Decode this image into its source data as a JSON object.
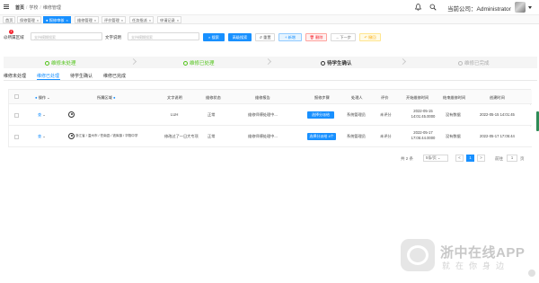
{
  "header": {
    "breadcrumb": [
      "首页",
      "学校",
      "维修管理"
    ],
    "company_label": "当前公司：Administrator"
  },
  "tabs": [
    {
      "label": "首页",
      "closable": false,
      "active": false
    },
    {
      "label": "保修管理",
      "closable": true,
      "active": false
    },
    {
      "label": "报修审核",
      "closable": true,
      "active": true
    },
    {
      "label": "维修管理",
      "closable": true,
      "active": false
    },
    {
      "label": "评价管理",
      "closable": true,
      "active": false
    },
    {
      "label": "任务指派",
      "closable": true,
      "active": false
    },
    {
      "label": "申请记录",
      "closable": true,
      "active": false
    }
  ],
  "filter": {
    "required_badge": "1",
    "field1_label": "@所属区域",
    "field1_placeholder": "支持模糊搜索",
    "field2_label": "文字说明",
    "field2_placeholder": "支持模糊搜索",
    "search_label": "搜索",
    "advanced_label": "高级搜索",
    "reset_label": "重置",
    "add_label": "+ 新增",
    "delete_label": "删除",
    "next_label": "下一步",
    "revoke_label": "撤回"
  },
  "steps": [
    {
      "label": "维修未处理",
      "state": "done"
    },
    {
      "label": "维修已处理",
      "state": "done"
    },
    {
      "label": "待学生确认",
      "state": "current"
    },
    {
      "label": "维修已完成",
      "state": "todo"
    }
  ],
  "subtabs": [
    {
      "label": "维修未处理",
      "active": false
    },
    {
      "label": "维修已处理",
      "active": true
    },
    {
      "label": "待学生确认",
      "active": false
    },
    {
      "label": "维修已完成",
      "active": false
    }
  ],
  "table": {
    "headers": [
      "操作",
      "所属区域",
      "文字说明",
      "维修状态",
      "维修报告",
      "报修步骤",
      "处理人",
      "评价",
      "开始维修时间",
      "结束维修时间",
      "创建时间"
    ],
    "rows": [
      {
        "op": "查",
        "area": "",
        "desc": "LUH",
        "status": "正常",
        "report": "维修师傅处理中...",
        "action": "选择分派给",
        "handler": "系统管理员",
        "rating": "未评分",
        "start": "2022-05-15 14:01:45.0000",
        "end": "没有数据",
        "created": "2022-05-15 14:01:45"
      },
      {
        "op": "查",
        "area": "浙江省 / 温州市 / 苍南县 / 钱库镇 / 华翔中学",
        "desc": "修改过了一日大专项",
        "status": "正常",
        "report": "维修师傅处理中...",
        "action": "选择分派给 4个",
        "handler": "系统管理员",
        "rating": "未评分",
        "start": "2022-05-17 17:05:44.0000",
        "end": "没有数据",
        "created": "2022-05-17 17:05:44"
      }
    ]
  },
  "pagination": {
    "total": "共 2 条",
    "page_size": "5条/页",
    "prev": "<",
    "current": "1",
    "next": ">",
    "goto_label": "前往",
    "goto_value": "1",
    "page_unit": "页"
  },
  "watermark": {
    "title": "浙中在线APP",
    "subtitle": "就在你身边"
  }
}
